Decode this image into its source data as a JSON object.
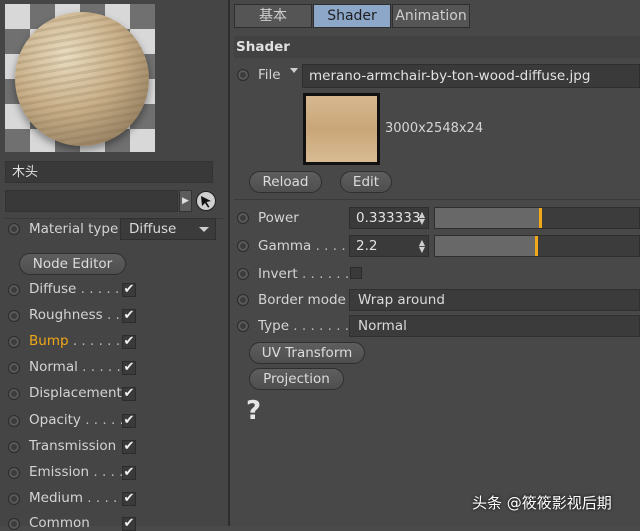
{
  "material": {
    "name": "木头",
    "search_value": "",
    "material_type_label": "Material type",
    "material_type_value": "Diffuse",
    "node_editor_label": "Node Editor",
    "channels": [
      {
        "label": "Diffuse",
        "dots": " . . . . . .",
        "checked": true,
        "highlight": false
      },
      {
        "label": "Roughness",
        "dots": " . .",
        "checked": true,
        "highlight": false
      },
      {
        "label": "Bump",
        "dots": " . . . . . . .",
        "checked": true,
        "highlight": true
      },
      {
        "label": "Normal",
        "dots": " . . . . . .",
        "checked": true,
        "highlight": false
      },
      {
        "label": "Displacement",
        "dots": "",
        "checked": true,
        "highlight": false
      },
      {
        "label": "Opacity",
        "dots": " . . . . .",
        "checked": true,
        "highlight": false
      },
      {
        "label": "Transmission",
        "dots": "",
        "checked": true,
        "highlight": false
      },
      {
        "label": "Emission",
        "dots": " . . . .",
        "checked": true,
        "highlight": false
      },
      {
        "label": "Medium",
        "dots": " . . . . .",
        "checked": true,
        "highlight": false
      },
      {
        "label": "Common",
        "dots": "",
        "checked": true,
        "highlight": false
      }
    ],
    "check_glyph": "✔"
  },
  "tabs": [
    {
      "label": "基本",
      "active": false
    },
    {
      "label": "Shader",
      "active": true
    },
    {
      "label": "Animation",
      "active": false
    }
  ],
  "shader": {
    "section_title": "Shader",
    "file_label": "File",
    "file_value": "merano-armchair-by-ton-wood-diffuse.jpg",
    "image_info": "3000x2548x24",
    "reload_label": "Reload",
    "edit_label": "Edit",
    "power_label": "Power",
    "power_value": "0.333333",
    "power_fraction": 0.51,
    "gamma_label": "Gamma",
    "gamma_dots": " . . . .",
    "gamma_value": "2.2",
    "gamma_fraction": 0.49,
    "invert_label": "Invert",
    "invert_dots": " . . . . . .",
    "border_mode_label": "Border mode",
    "border_mode_value": "Wrap around",
    "type_label": "Type",
    "type_dots": " . . . . . . .",
    "type_value": "Normal",
    "uv_transform_label": "UV Transform",
    "projection_label": "Projection",
    "help_glyph": "?"
  },
  "colors": {
    "active_tab": "#8da7c9",
    "highlight_label": "#f0a818",
    "slider_thumb": "#f0a818"
  },
  "watermark": "头条 @筱筱影视后期"
}
